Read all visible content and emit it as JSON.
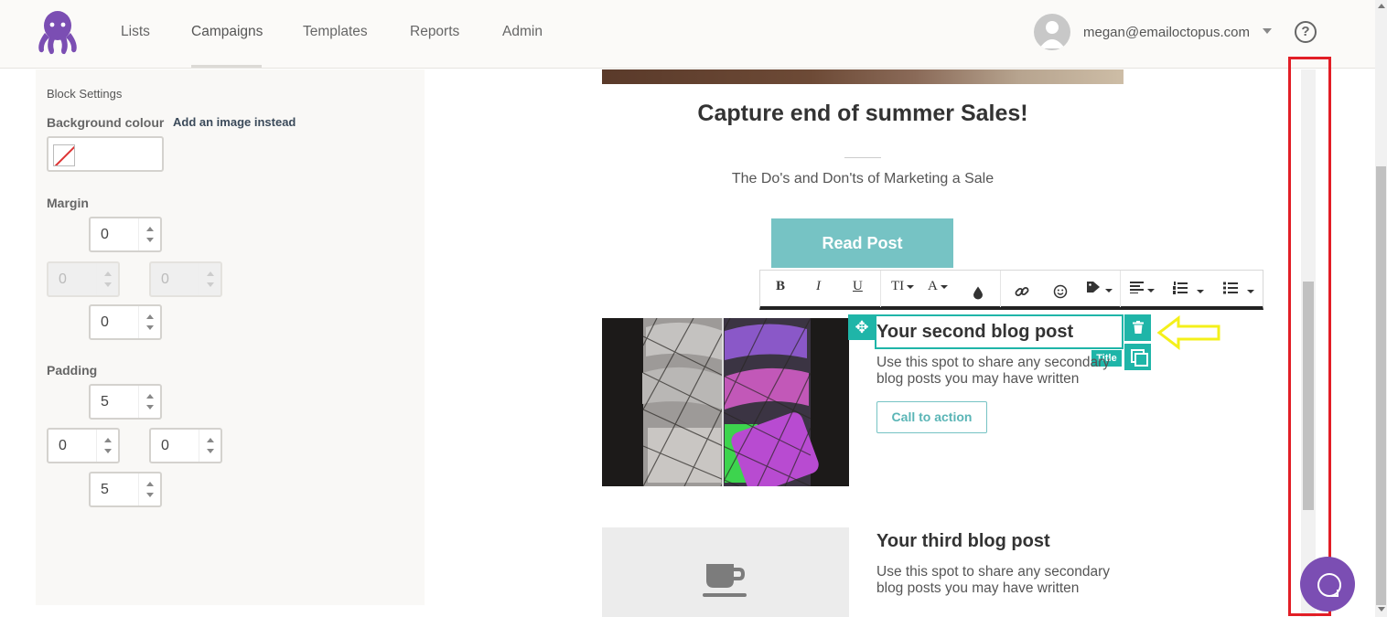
{
  "nav": {
    "items": [
      "Lists",
      "Campaigns",
      "Templates",
      "Reports",
      "Admin"
    ],
    "active": "Campaigns",
    "user_email": "megan@emailoctopus.com"
  },
  "settings": {
    "heading": "Block Settings",
    "background_label": "Background colour",
    "add_image_link": "Add an image instead",
    "margin_label": "Margin",
    "margin": {
      "top": "0",
      "left": "0",
      "right": "0",
      "bottom": "0"
    },
    "padding_label": "Padding",
    "padding": {
      "top": "5",
      "left": "0",
      "right": "0",
      "bottom": "5"
    }
  },
  "email": {
    "hero_title": "Capture end of summer Sales!",
    "hero_subtitle": "The Do's and Don'ts of Marketing a Sale",
    "read_button": "Read Post",
    "post2": {
      "title": "Your second blog post",
      "body_line1": "Use this spot to share any secondary",
      "body_line2": "blog posts you may have written",
      "cta": "Call to action",
      "tag": "Title"
    },
    "post3": {
      "title": "Your third blog post",
      "body_line1": "Use this spot to share any secondary",
      "body_line2": "blog posts you may have written"
    }
  },
  "toolbar": {
    "bold": "B",
    "italic": "I",
    "underline": "U",
    "text_style": "TI",
    "font_color": "A"
  },
  "colors": {
    "brand": "#7b4eb3",
    "teal": "#1fb5a8",
    "button": "#76c3c4",
    "highlight_box": "#e21e26",
    "annotation_arrow": "#f4f01a"
  }
}
